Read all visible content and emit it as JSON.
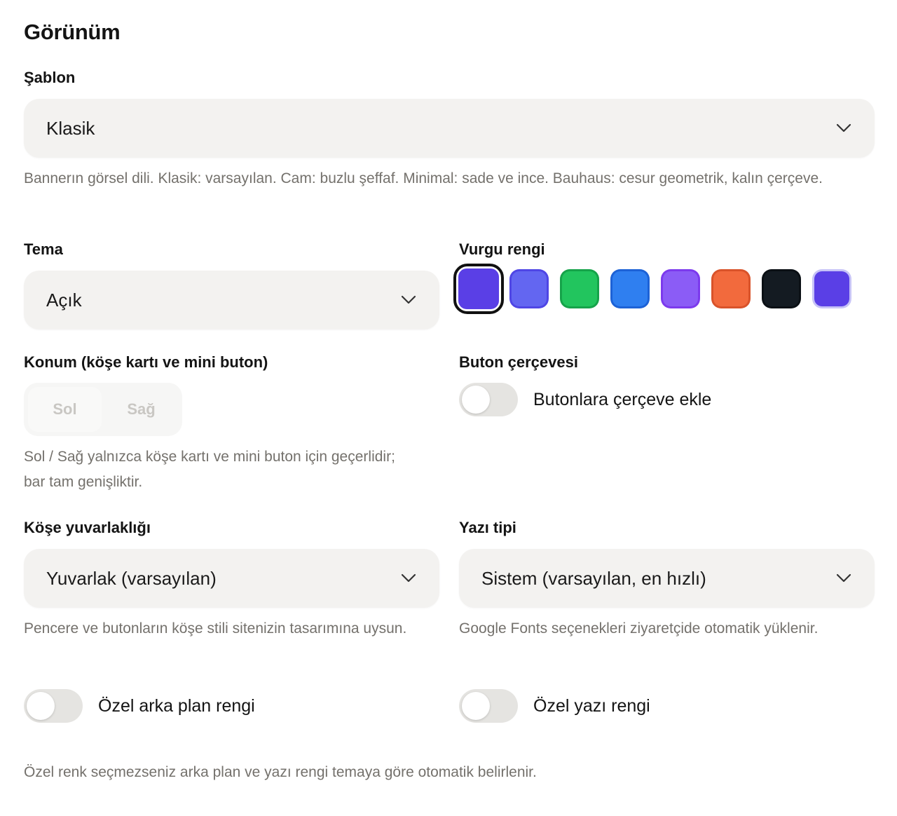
{
  "section_title": "Görünüm",
  "template": {
    "label": "Şablon",
    "value": "Klasik",
    "help": "Bannerın görsel dili. Klasik: varsayılan. Cam: buzlu şeffaf. Minimal: sade ve ince. Bauhaus: cesur geometrik, kalın çerçeve."
  },
  "theme": {
    "label": "Tema",
    "value": "Açık"
  },
  "accent": {
    "label": "Vurgu rengi",
    "selected_index": 0,
    "colors": [
      {
        "fill": "#5a3fe6",
        "edge": "#3d25cf"
      },
      {
        "fill": "#6366f1",
        "edge": "#4f46e5"
      },
      {
        "fill": "#22c55e",
        "edge": "#16a34a"
      },
      {
        "fill": "#2f7ff0",
        "edge": "#1d62d6"
      },
      {
        "fill": "#8b5cf6",
        "edge": "#7c3aed"
      },
      {
        "fill": "#f26a3d",
        "edge": "#d9532a"
      },
      {
        "fill": "#141b22",
        "edge": "#0b1015"
      },
      {
        "fill": "#5a3fe6",
        "edge": "#c7c3f7"
      }
    ]
  },
  "position": {
    "label": "Konum (köşe kartı ve mini buton)",
    "options": [
      "Sol",
      "Sağ"
    ],
    "help": "Sol / Sağ yalnızca köşe kartı ve mini buton için geçerlidir; bar tam genişliktir."
  },
  "button_border": {
    "label": "Buton çerçevesi",
    "toggle_label": "Butonlara çerçeve ekle",
    "enabled": false
  },
  "corner": {
    "label": "Köşe yuvarlaklığı",
    "value": "Yuvarlak (varsayılan)",
    "help": "Pencere ve butonların köşe stili sitenizin tasarımına uysun."
  },
  "font": {
    "label": "Yazı tipi",
    "value": "Sistem (varsayılan, en hızlı)",
    "help": "Google Fonts seçenekleri ziyaretçide otomatik yüklenir."
  },
  "custom_bg": {
    "label": "Özel arka plan rengi",
    "enabled": false
  },
  "custom_text": {
    "label": "Özel yazı rengi",
    "enabled": false
  },
  "footer_note": "Özel renk seçmezseniz arka plan ve yazı rengi temaya göre otomatik belirlenir."
}
